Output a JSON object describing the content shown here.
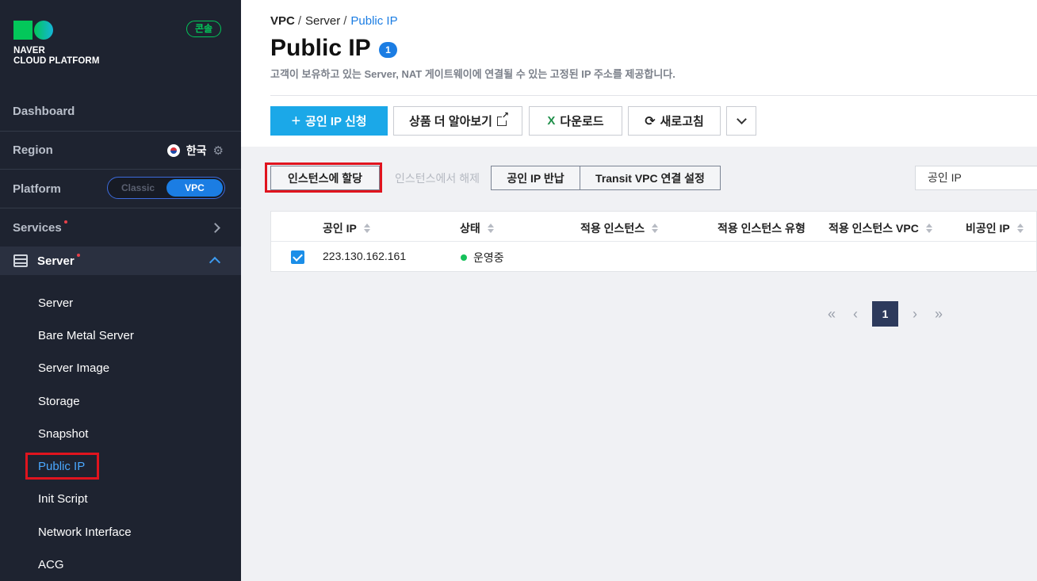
{
  "sidebar": {
    "logo": {
      "line1": "NAVER",
      "line2": "CLOUD PLATFORM"
    },
    "console_label": "콘솔",
    "dashboard": "Dashboard",
    "region": {
      "label": "Region",
      "value": "한국"
    },
    "platform": {
      "label": "Platform",
      "classic": "Classic",
      "vpc": "VPC"
    },
    "services": "Services",
    "server_group": "Server",
    "sub_items": [
      "Server",
      "Bare Metal Server",
      "Server Image",
      "Storage",
      "Snapshot",
      "Public IP",
      "Init Script",
      "Network Interface",
      "ACG"
    ]
  },
  "breadcrumb": {
    "b1": "VPC",
    "b2": "Server",
    "b3": "Public IP",
    "sep": "/"
  },
  "page": {
    "title": "Public IP",
    "count": "1",
    "description": "고객이 보유하고 있는 Server, NAT 게이트웨이에 연결될 수 있는 고정된 IP 주소를 제공합니다."
  },
  "toolbar": {
    "request": "공인 IP 신청",
    "learn_more": "상품 더 알아보기",
    "download": "다운로드",
    "download_icon": "X",
    "refresh": "새로고침"
  },
  "actions": {
    "assign": "인스턴스에 할당",
    "release": "인스턴스에서 해제",
    "return": "공인 IP 반납",
    "transit": "Transit VPC 연결 설정"
  },
  "search": {
    "selected": "공인 IP"
  },
  "table": {
    "columns": [
      "공인 IP",
      "상태",
      "적용 인스턴스",
      "적용 인스턴스 유형",
      "적용 인스턴스 VPC",
      "비공인 IP"
    ],
    "rows": [
      {
        "ip": "223.130.162.161",
        "status": "운영중"
      }
    ]
  },
  "pagination": {
    "current": "1"
  },
  "colors": {
    "accent": "#1ba8e8",
    "link": "#1b7de3",
    "sidebar_bg": "#1e2330",
    "highlight": "#e0141e",
    "status_ok": "#16c15a"
  }
}
